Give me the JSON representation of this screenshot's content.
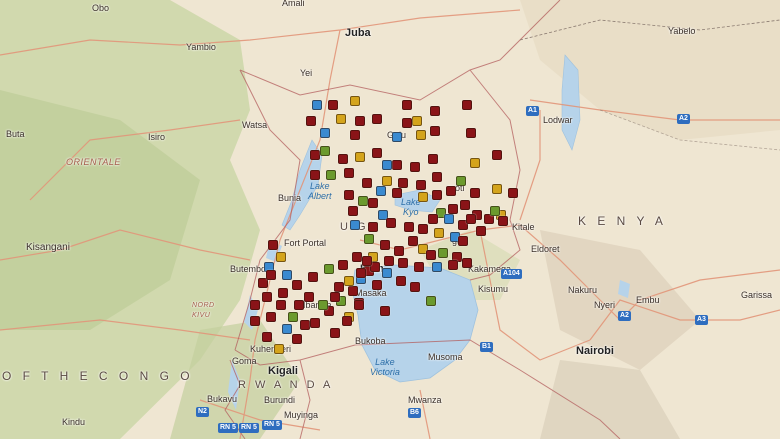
{
  "colors": {
    "land": "#efe6d2",
    "forest": "#c9d5a6",
    "lake": "#b6d3ea",
    "border": "#b35d5d",
    "road": "#e2967a",
    "marker_red": "#8a1418",
    "marker_yellow": "#d4a41c",
    "marker_green": "#6b9a2e",
    "marker_blue": "#3a8ad0"
  },
  "labels": {
    "obo": "Obo",
    "amali": "Amali",
    "juba": "Juba",
    "yambio": "Yambio",
    "yabelo": "Yabelo",
    "yei": "Yei",
    "buta": "Buta",
    "isiro": "Isiro",
    "watsa": "Watsa",
    "lodwar": "Lodwar",
    "orientale": "ORIENTALE",
    "bunia": "Bunia",
    "lake_albert": "Lake\nAlbert",
    "lake_kyoga": "Lake\nKyo",
    "kisangani": "Kisangani",
    "kenya": "K E N Y A",
    "kitale": "Kitale",
    "eldoret": "Eldoret",
    "fort_portal": "Fort Portal",
    "uganda": "U G",
    "butembo": "Butembo",
    "kampala": "Kam",
    "kakamega": "Kakamega",
    "kisumu": "Kisumu",
    "nakuru": "Nakuru",
    "nyeri": "Nyeri",
    "embu": "Embu",
    "garissa": "Garissa",
    "nord_kivu": "NORD\nKIVU",
    "mbarara": "Mbarara",
    "masaka": "Masaka",
    "goma": "Goma",
    "kuhengeri": "Kuhengeri",
    "bukoba": "Bukoba",
    "lake_victoria": "Lake\nVictoria",
    "musoma": "Musoma",
    "nairobi": "Nairobi",
    "of_the_congo": "O F   T H E   C O N G O",
    "kigali": "Kigali",
    "rwanda": "R W A N D A",
    "bukavu": "Bukavu",
    "burundi": "Burundi",
    "muyinga": "Muyinga",
    "mwanza": "Mwanza",
    "kindu": "Kindu",
    "gulu_partial": "Gulu",
    "soroti_partial": "oroti",
    "mbale_partial": "ga"
  },
  "shields": {
    "a1": "A1",
    "a2": "A2",
    "a2b": "A2",
    "a3": "A3",
    "a104": "A104",
    "b1": "B1",
    "b6": "B6",
    "n2": "N2",
    "rn5": "RN 5",
    "rn5b": "RN 5",
    "rn5c": "RN 5"
  },
  "markers": [
    {
      "c": "blue"
    },
    {
      "c": "red"
    },
    {
      "c": "yellow"
    },
    {
      "c": "red"
    },
    {
      "c": "red"
    },
    {
      "c": "red"
    },
    {
      "c": "yellow"
    },
    {
      "c": "red"
    },
    {
      "c": "red"
    },
    {
      "c": "blue"
    },
    {
      "c": "yellow"
    },
    {
      "c": "red"
    },
    {
      "c": "red"
    },
    {
      "c": "red"
    },
    {
      "c": "blue"
    },
    {
      "c": "yellow"
    },
    {
      "c": "red"
    },
    {
      "c": "red"
    },
    {
      "c": "red"
    },
    {
      "c": "green"
    },
    {
      "c": "red"
    },
    {
      "c": "yellow"
    },
    {
      "c": "red"
    },
    {
      "c": "red"
    },
    {
      "c": "red"
    },
    {
      "c": "blue"
    },
    {
      "c": "red"
    },
    {
      "c": "yellow"
    },
    {
      "c": "red"
    },
    {
      "c": "red"
    },
    {
      "c": "green"
    },
    {
      "c": "red"
    },
    {
      "c": "red"
    },
    {
      "c": "yellow"
    },
    {
      "c": "blue"
    },
    {
      "c": "red"
    },
    {
      "c": "red"
    },
    {
      "c": "red"
    },
    {
      "c": "green"
    },
    {
      "c": "red"
    },
    {
      "c": "yellow"
    },
    {
      "c": "red"
    },
    {
      "c": "red"
    },
    {
      "c": "green"
    },
    {
      "c": "red"
    },
    {
      "c": "red"
    },
    {
      "c": "blue"
    },
    {
      "c": "red"
    },
    {
      "c": "yellow"
    },
    {
      "c": "red"
    },
    {
      "c": "red"
    },
    {
      "c": "red"
    },
    {
      "c": "green"
    },
    {
      "c": "red"
    },
    {
      "c": "blue"
    },
    {
      "c": "red"
    },
    {
      "c": "red"
    },
    {
      "c": "red"
    },
    {
      "c": "yellow"
    },
    {
      "c": "red"
    },
    {
      "c": "red"
    },
    {
      "c": "green"
    },
    {
      "c": "blue"
    },
    {
      "c": "red"
    },
    {
      "c": "red"
    },
    {
      "c": "red"
    },
    {
      "c": "red"
    },
    {
      "c": "yellow"
    },
    {
      "c": "blue"
    },
    {
      "c": "red"
    },
    {
      "c": "red"
    },
    {
      "c": "red"
    },
    {
      "c": "green"
    },
    {
      "c": "red"
    },
    {
      "c": "red"
    },
    {
      "c": "red"
    },
    {
      "c": "yellow"
    },
    {
      "c": "red"
    },
    {
      "c": "green"
    },
    {
      "c": "red"
    },
    {
      "c": "red"
    },
    {
      "c": "red"
    },
    {
      "c": "blue"
    },
    {
      "c": "red"
    },
    {
      "c": "red"
    },
    {
      "c": "red"
    },
    {
      "c": "yellow"
    },
    {
      "c": "red"
    },
    {
      "c": "red"
    },
    {
      "c": "green"
    },
    {
      "c": "red"
    },
    {
      "c": "red"
    },
    {
      "c": "red"
    },
    {
      "c": "blue"
    },
    {
      "c": "red"
    },
    {
      "c": "yellow"
    },
    {
      "c": "red"
    },
    {
      "c": "red"
    },
    {
      "c": "red"
    },
    {
      "c": "green"
    },
    {
      "c": "red"
    },
    {
      "c": "blue"
    },
    {
      "c": "red"
    },
    {
      "c": "red"
    },
    {
      "c": "red"
    },
    {
      "c": "red"
    },
    {
      "c": "yellow"
    },
    {
      "c": "red"
    },
    {
      "c": "red"
    },
    {
      "c": "red"
    },
    {
      "c": "green"
    },
    {
      "c": "red"
    },
    {
      "c": "blue"
    },
    {
      "c": "red"
    },
    {
      "c": "red"
    },
    {
      "c": "red"
    },
    {
      "c": "yellow"
    },
    {
      "c": "red"
    },
    {
      "c": "red"
    },
    {
      "c": "red"
    },
    {
      "c": "green"
    },
    {
      "c": "red"
    },
    {
      "c": "red"
    },
    {
      "c": "blue"
    },
    {
      "c": "red"
    },
    {
      "c": "red"
    },
    {
      "c": "red"
    },
    {
      "c": "yellow"
    },
    {
      "c": "red"
    },
    {
      "c": "red"
    },
    {
      "c": "green"
    },
    {
      "c": "red"
    },
    {
      "c": "red"
    },
    {
      "c": "blue"
    },
    {
      "c": "red"
    },
    {
      "c": "red"
    }
  ]
}
